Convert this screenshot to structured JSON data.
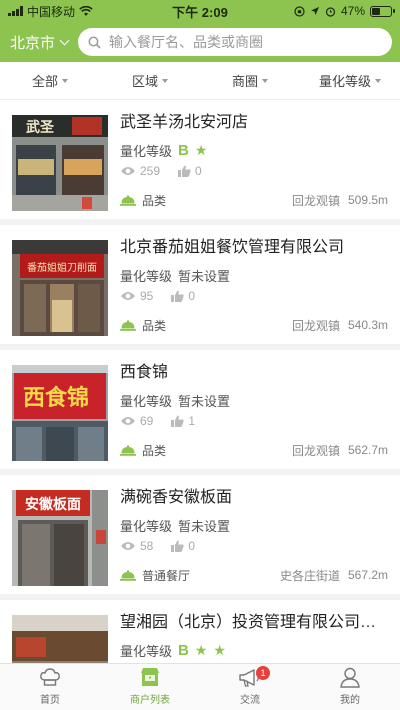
{
  "status_bar": {
    "carrier": "中国移动",
    "time": "下午 2:09",
    "battery": "47%",
    "battery_level": 0.47
  },
  "header": {
    "city": "北京市",
    "search_placeholder": "输入餐厅名、品类或商圈"
  },
  "filters": [
    "全部",
    "区域",
    "商圈",
    "量化等级"
  ],
  "labels": {
    "grade": "量化等级",
    "not_set": "暂未设置"
  },
  "items": [
    {
      "name": "武圣羊汤北安河店",
      "grade": "B",
      "stars": 1,
      "views": "259",
      "likes": "0",
      "category": "品类",
      "area": "回龙观镇",
      "distance": "509.5m",
      "sign_text": "武圣"
    },
    {
      "name": "北京番茄姐姐餐饮管理有限公司",
      "grade": "",
      "stars": 0,
      "views": "95",
      "likes": "0",
      "category": "品类",
      "area": "回龙观镇",
      "distance": "540.3m",
      "sign_text": "番茄姐姐刀削面"
    },
    {
      "name": "西食锦",
      "grade": "",
      "stars": 0,
      "views": "69",
      "likes": "1",
      "category": "品类",
      "area": "回龙观镇",
      "distance": "562.7m",
      "sign_text": "西食锦"
    },
    {
      "name": "满碗香安徽板面",
      "grade": "",
      "stars": 0,
      "views": "58",
      "likes": "0",
      "category": "普通餐厅",
      "area": "史各庄街道",
      "distance": "567.2m",
      "sign_text": "安徽板面"
    },
    {
      "name": "望湘园（北京）投资管理有限公司北...",
      "grade": "B",
      "stars": 2,
      "views": "",
      "likes": "",
      "category": "",
      "area": "",
      "distance": "",
      "sign_text": ""
    }
  ],
  "tabs": [
    {
      "label": "首页",
      "icon": "chef-hat-icon",
      "active": false
    },
    {
      "label": "商户列表",
      "icon": "storefront-icon",
      "active": true
    },
    {
      "label": "交流",
      "icon": "megaphone-icon",
      "active": false,
      "badge": "1"
    },
    {
      "label": "我的",
      "icon": "user-icon",
      "active": false
    }
  ],
  "colors": {
    "brand": "#8cc44f",
    "active_tab": "#6da838",
    "badge": "#e8413a"
  }
}
